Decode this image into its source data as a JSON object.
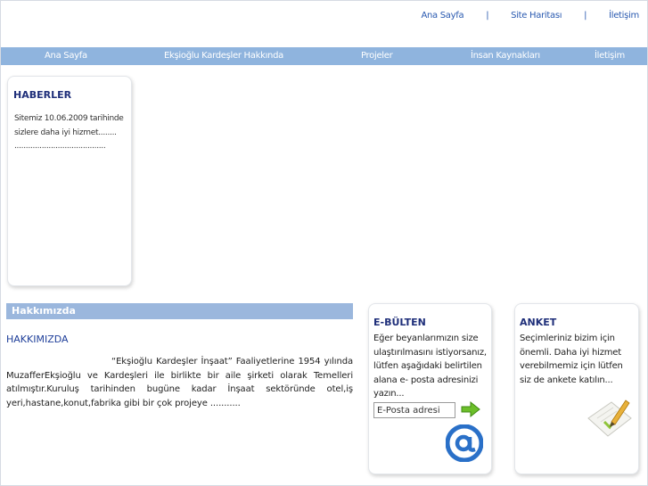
{
  "top_links": {
    "home": "Ana Sayfa",
    "sitemap": "Site Haritası",
    "contact": "İletişim",
    "separator": "|"
  },
  "nav": {
    "items": [
      {
        "label": "Ana Sayfa"
      },
      {
        "label": "Ekşioğlu Kardeşler Hakkında"
      },
      {
        "label": "Projeler"
      },
      {
        "label": "İnsan Kaynakları"
      },
      {
        "label": "İletişim"
      }
    ],
    "background_color": "#8fb4de"
  },
  "news": {
    "title": "HABERLER",
    "line1": "Sitemiz 10.06.2009 tarihinde",
    "line2": "sizlere daha iyi hizmet........",
    "line3": "........................................"
  },
  "about": {
    "bar_label": "Hakkımızda",
    "heading": "HAKKIMIZDA",
    "body": "“Ekşioğlu Kardeşler İnşaat” Faaliyetlerine 1954 yılında MuzafferEkşioğlu ve Kardeşleri ile birlikte bir aile şirketi olarak Temelleri atılmıştır.Kuruluş tarihinden bugüne kadar İnşaat sektöründe otel,iş yeri,hastane,konut,fabrika  gibi bir çok projeye ..........."
  },
  "bulten": {
    "title": "E-BÜLTEN",
    "text": "Eğer beyanlarımızın size ulaştırılmasını istiyorsanız, lütfen aşağıdaki belirtilen alana e- posta adresinizi yazın...",
    "email_value": "E-Posta adresi",
    "submit_icon": "green-arrow-icon",
    "at_icon": "at-sign-icon"
  },
  "anket": {
    "title": "ANKET",
    "text": "Seçimleriniz bizim için önemli. Daha iyi hizmet verebilmemiz için lütfen siz de ankete katılın...",
    "icon": "notepad-pencil-icon"
  }
}
